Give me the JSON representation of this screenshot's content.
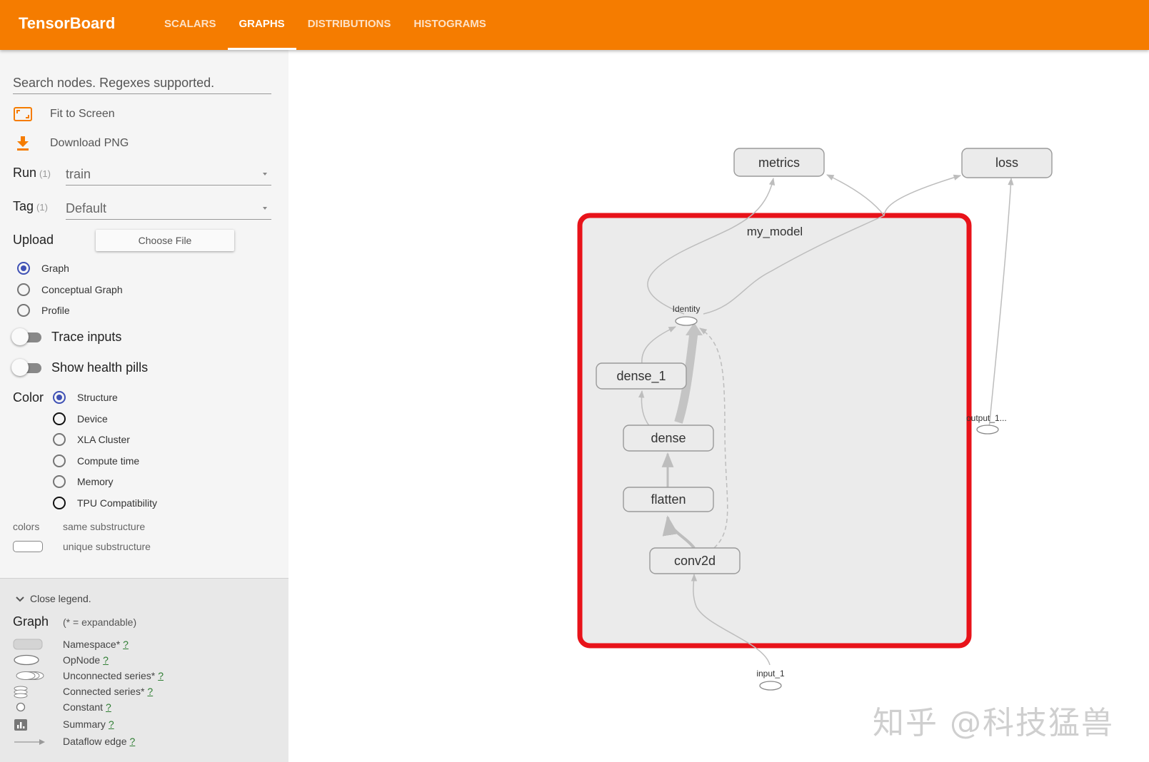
{
  "app": {
    "title": "TensorBoard",
    "tabs": [
      "SCALARS",
      "GRAPHS",
      "DISTRIBUTIONS",
      "HISTOGRAMS"
    ],
    "active_tab": "GRAPHS",
    "accent_color": "#f57c00"
  },
  "sidebar": {
    "search_placeholder": "Search nodes. Regexes supported.",
    "fit_to_screen": "Fit to Screen",
    "download_png": "Download PNG",
    "run_label": "Run",
    "run_count": "(1)",
    "run_value": "train",
    "tag_label": "Tag",
    "tag_count": "(1)",
    "tag_value": "Default",
    "upload_label": "Upload",
    "choose_file": "Choose File",
    "graph_types": [
      "Graph",
      "Conceptual Graph",
      "Profile"
    ],
    "selected_graph_type": "Graph",
    "trace_inputs": "Trace inputs",
    "show_health_pills": "Show health pills",
    "color_label": "Color",
    "color_options": [
      "Structure",
      "Device",
      "XLA Cluster",
      "Compute time",
      "Memory",
      "TPU Compatibility"
    ],
    "selected_color": "Structure",
    "colors_label": "colors",
    "same_substructure": "same substructure",
    "unique_substructure": "unique substructure"
  },
  "legend": {
    "close_legend": "Close legend.",
    "graph_label": "Graph",
    "expandable_note": "(* = expandable)",
    "items": [
      "Namespace*",
      "OpNode",
      "Unconnected series*",
      "Connected series*",
      "Constant",
      "Summary",
      "Dataflow edge"
    ],
    "help": "?"
  },
  "graph": {
    "namespace": "my_model",
    "nodes": {
      "metrics": "metrics",
      "loss": "loss",
      "identity": "Identity",
      "dense_1": "dense_1",
      "dense": "dense",
      "flatten": "flatten",
      "conv2d": "conv2d",
      "input_1": "input_1",
      "output_1": "output_1..."
    },
    "highlight_color": "#e8131a"
  },
  "watermark": "知乎 @科技猛兽"
}
